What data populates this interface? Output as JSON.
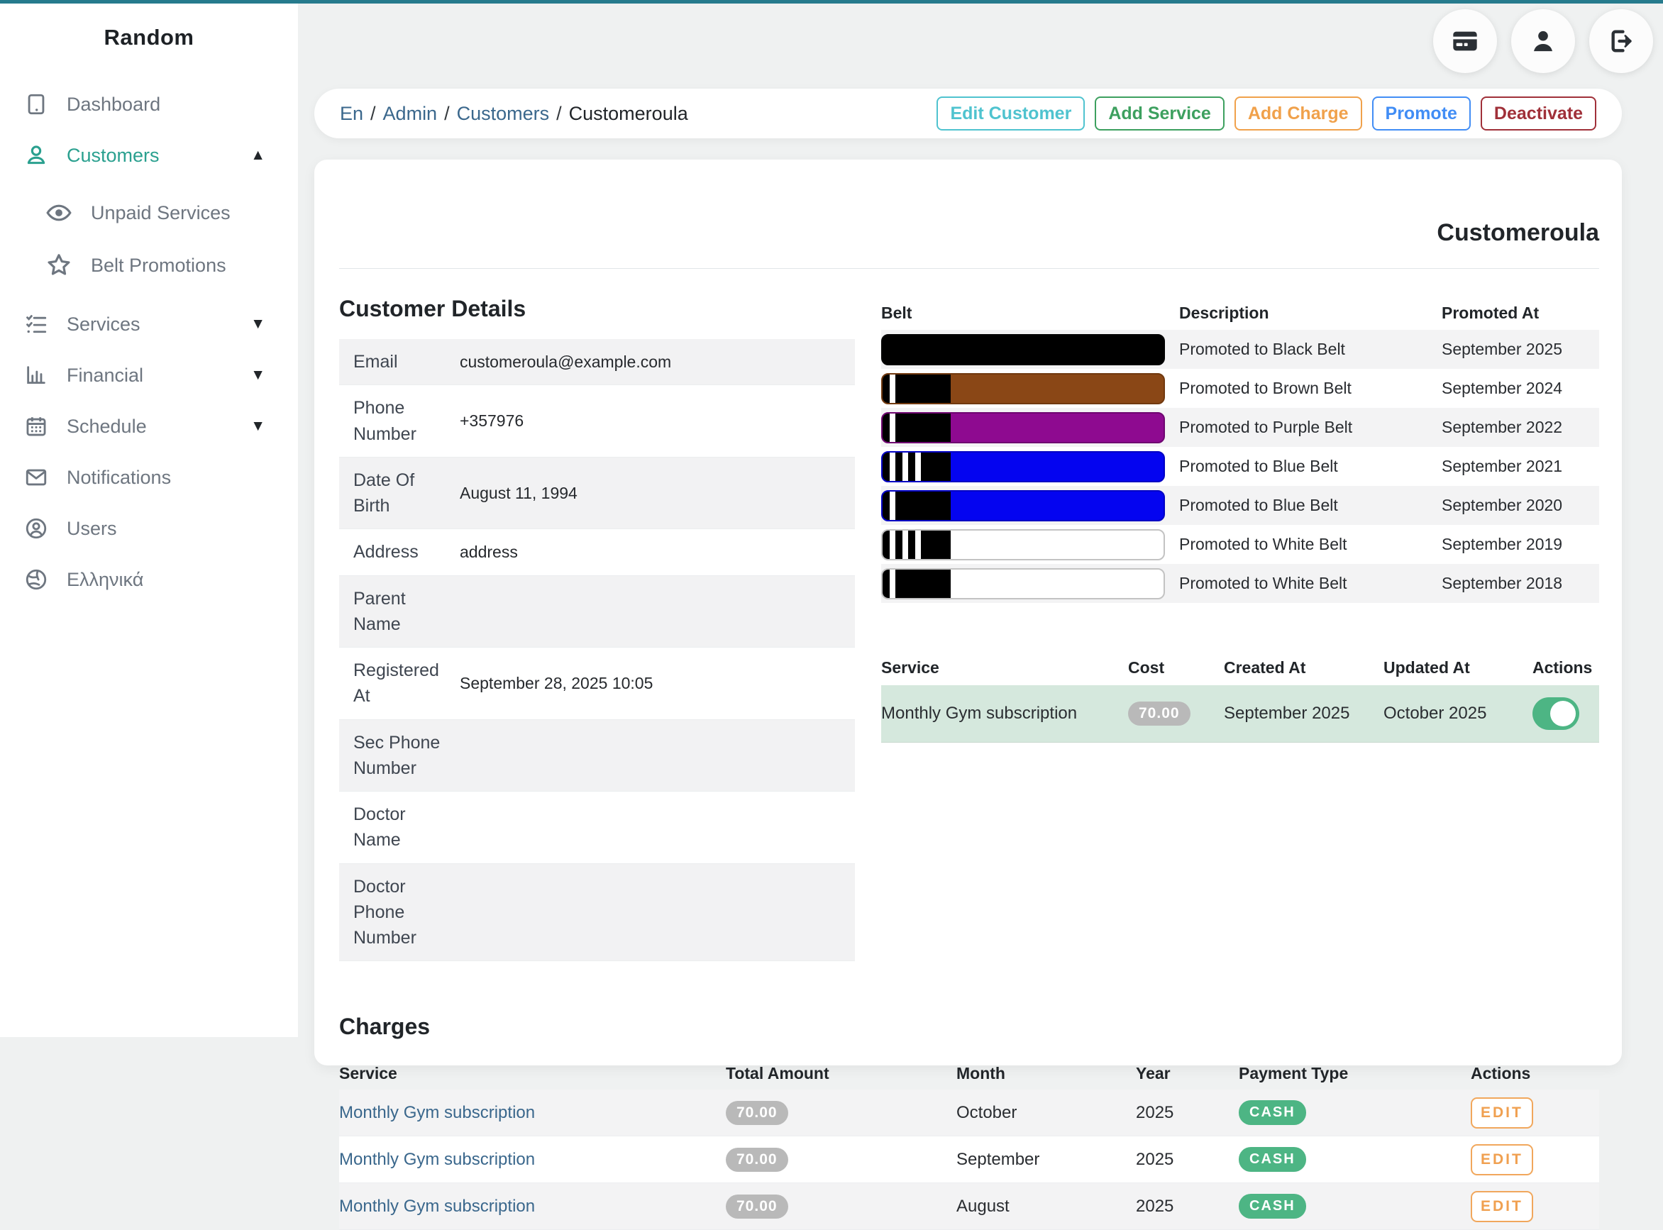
{
  "brand": "Random",
  "topbar": {
    "icons": [
      "credit-card",
      "user",
      "logout"
    ]
  },
  "sidebar": {
    "items": [
      {
        "label": "Dashboard"
      },
      {
        "label": "Customers",
        "active": true,
        "caret": "▲"
      },
      {
        "label": "Unpaid Services"
      },
      {
        "label": "Belt Promotions"
      },
      {
        "label": "Services",
        "caret": "▼"
      },
      {
        "label": "Financial",
        "caret": "▼"
      },
      {
        "label": "Schedule",
        "caret": "▼"
      },
      {
        "label": "Notifications"
      },
      {
        "label": "Users"
      },
      {
        "label": "Ελληνικά"
      }
    ]
  },
  "breadcrumb": {
    "separator": "/",
    "links": [
      {
        "label": "En"
      },
      {
        "label": "Admin"
      },
      {
        "label": "Customers"
      }
    ],
    "current": "Customeroula"
  },
  "actions": {
    "edit_customer": "Edit Customer",
    "add_service": "Add Service",
    "add_charge": "Add Charge",
    "promote": "Promote",
    "deactivate": "Deactivate"
  },
  "page": {
    "title": "Customeroula"
  },
  "details": {
    "heading": "Customer Details",
    "rows": [
      {
        "label": "Email",
        "value": "customeroula@example.com"
      },
      {
        "label": "Phone Number",
        "value": "+357976"
      },
      {
        "label": "Date Of Birth",
        "value": "August 11, 1994"
      },
      {
        "label": "Address",
        "value": "address"
      },
      {
        "label": "Parent Name",
        "value": ""
      },
      {
        "label": "Registered At",
        "value": "September 28, 2025 10:05"
      },
      {
        "label": "Sec Phone Number",
        "value": ""
      },
      {
        "label": "Doctor Name",
        "value": ""
      },
      {
        "label": "Doctor Phone Number",
        "value": ""
      }
    ]
  },
  "belts": {
    "headers": {
      "belt": "Belt",
      "description": "Description",
      "promoted_at": "Promoted At"
    },
    "rows": [
      {
        "belt": "black-belt",
        "stripes": 0,
        "description": "Promoted to Black Belt",
        "promoted_at": "September 2025"
      },
      {
        "belt": "brown-belt",
        "stripes": 1,
        "description": "Promoted to Brown Belt",
        "promoted_at": "September 2024"
      },
      {
        "belt": "purple-belt",
        "stripes": 1,
        "description": "Promoted to Purple Belt",
        "promoted_at": "September 2022"
      },
      {
        "belt": "blue-belt",
        "stripes": 3,
        "description": "Promoted to Blue Belt",
        "promoted_at": "September 2021"
      },
      {
        "belt": "blue-belt",
        "stripes": 1,
        "description": "Promoted to Blue Belt",
        "promoted_at": "September 2020"
      },
      {
        "belt": "white-belt",
        "stripes": 3,
        "description": "Promoted to White Belt",
        "promoted_at": "September 2019"
      },
      {
        "belt": "white-belt",
        "stripes": 1,
        "description": "Promoted to White Belt",
        "promoted_at": "September 2018"
      }
    ]
  },
  "services": {
    "headers": {
      "service": "Service",
      "cost": "Cost",
      "created_at": "Created At",
      "updated_at": "Updated At",
      "actions": "Actions"
    },
    "rows": [
      {
        "service": "Monthly Gym subscription",
        "cost": "70.00",
        "created_at": "September 2025",
        "updated_at": "October 2025",
        "toggle": "on"
      }
    ]
  },
  "charges": {
    "heading": "Charges",
    "headers": {
      "service": "Service",
      "total_amount": "Total Amount",
      "month": "Month",
      "year": "Year",
      "payment_type": "Payment Type",
      "actions": "Actions"
    },
    "rows": [
      {
        "service": "Monthly Gym subscription",
        "total_amount": "70.00",
        "month": "October",
        "year": "2025",
        "payment_type": "CASH",
        "action": "EDIT"
      },
      {
        "service": "Monthly Gym subscription",
        "total_amount": "70.00",
        "month": "September",
        "year": "2025",
        "payment_type": "CASH",
        "action": "EDIT"
      },
      {
        "service": "Monthly Gym subscription",
        "total_amount": "70.00",
        "month": "August",
        "year": "2025",
        "payment_type": "CASH",
        "action": "EDIT"
      }
    ]
  },
  "colors": {
    "accent_teal_topline": "#267b8d",
    "sidebar_active": "#2aa08f",
    "link_blue": "#3a678c",
    "btn_edit_customer": "#4fc3cf",
    "btn_add_service": "#3da05f",
    "btn_add_charge": "#f0a14b",
    "btn_promote": "#418df5",
    "btn_deactivate": "#a03039",
    "badge_gray": "#b9b9b9",
    "badge_green": "#4db584",
    "toggle_green": "#4db584",
    "service_row_green": "#d5e8dd",
    "belt_black": "#000000",
    "belt_brown": "#8a4716",
    "belt_purple": "#8e0a90",
    "belt_blue": "#0404f0",
    "belt_white": "#ffffff"
  }
}
